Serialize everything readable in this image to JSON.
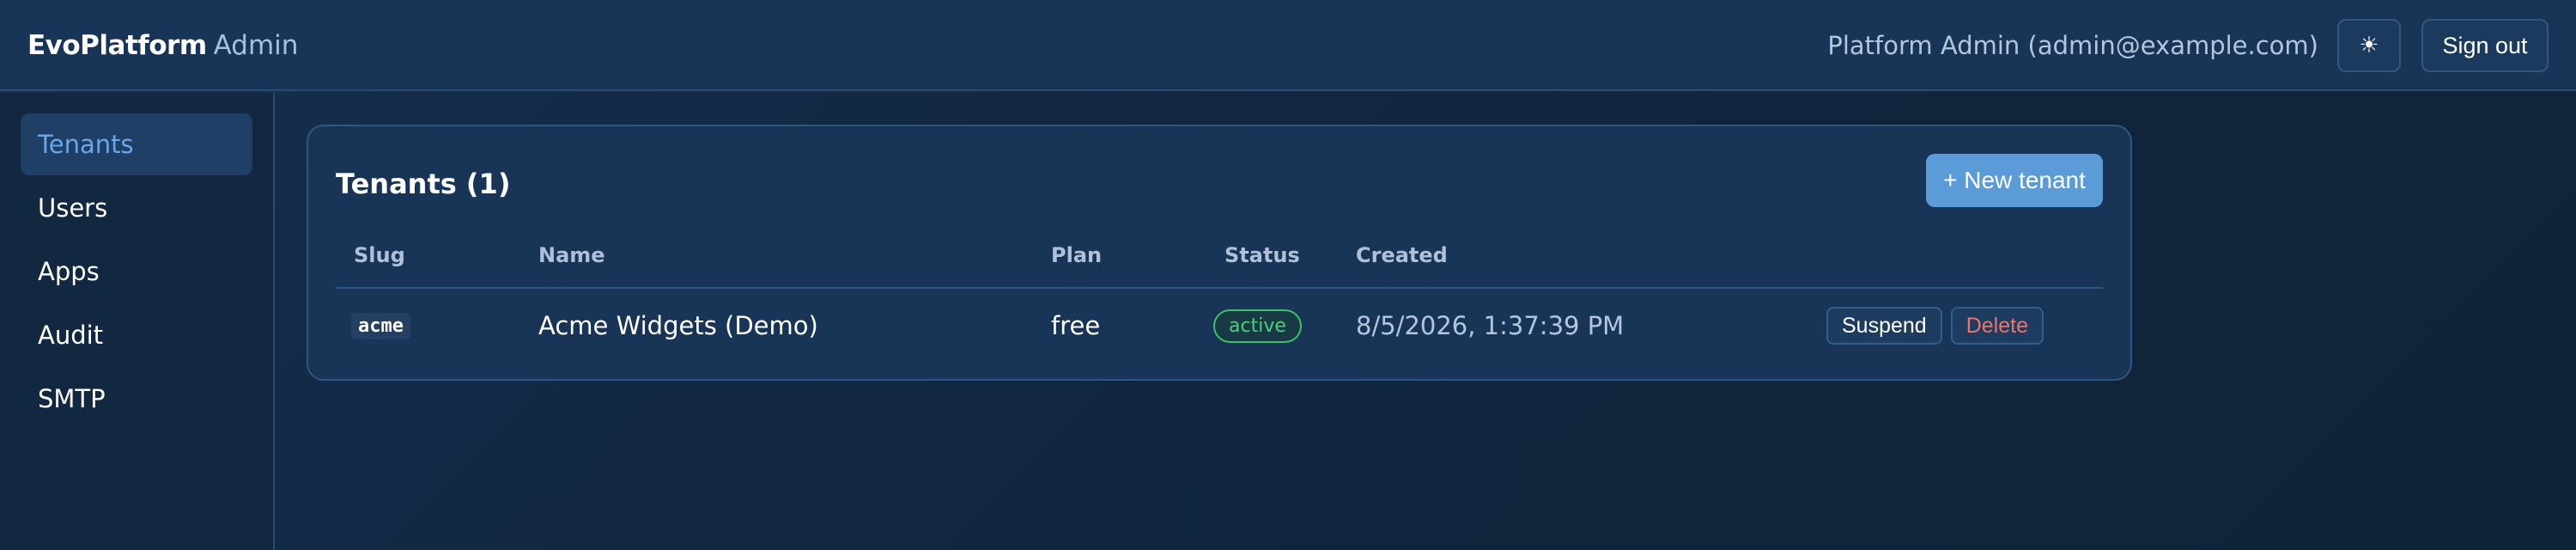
{
  "header": {
    "brand_main": "EvoPlatform",
    "brand_sub": "Admin",
    "user": "Platform Admin (admin@example.com)",
    "theme_icon": "sun-icon",
    "theme_glyph": "☀",
    "signout_label": "Sign out"
  },
  "sidebar": {
    "items": [
      {
        "label": "Tenants",
        "active": true
      },
      {
        "label": "Users"
      },
      {
        "label": "Apps"
      },
      {
        "label": "Audit"
      },
      {
        "label": "SMTP"
      }
    ]
  },
  "main": {
    "title": "Tenants (1)",
    "new_button": "+ New tenant",
    "columns": [
      "Slug",
      "Name",
      "Plan",
      "Status",
      "Created"
    ],
    "rows": [
      {
        "slug": "acme",
        "name": "Acme Widgets (Demo)",
        "plan": "free",
        "status": "active",
        "created": "8/5/2026, 1:37:39 PM",
        "actions": [
          "Suspend",
          "Delete"
        ]
      }
    ]
  },
  "colors": {
    "accent": "#5b9bd8",
    "active_nav": "#6aa7ea",
    "status_active": "#4ccf78",
    "danger": "#f0736b"
  }
}
